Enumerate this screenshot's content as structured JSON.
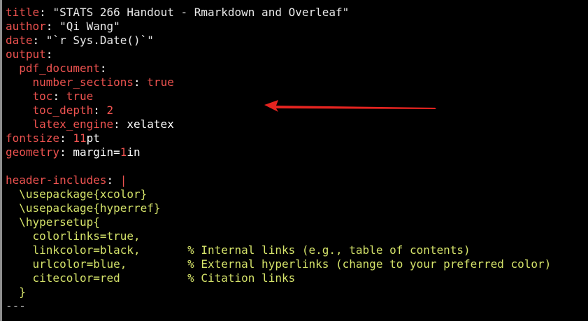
{
  "editor": {
    "lines": [
      {
        "name": "yaml-open-delim",
        "seg": [
          {
            "t": "---",
            "c": "fold"
          }
        ]
      },
      {
        "name": "title-line",
        "seg": [
          {
            "t": "title",
            "c": "k"
          },
          {
            "t": ": ",
            "c": "v"
          },
          {
            "t": "\"STATS 266 Handout - Rmarkdown and Overleaf\"",
            "c": "s"
          }
        ]
      },
      {
        "name": "author-line",
        "seg": [
          {
            "t": "author",
            "c": "k"
          },
          {
            "t": ": ",
            "c": "v"
          },
          {
            "t": "\"Qi Wang\"",
            "c": "s"
          }
        ]
      },
      {
        "name": "date-line",
        "seg": [
          {
            "t": "date",
            "c": "k"
          },
          {
            "t": ": ",
            "c": "v"
          },
          {
            "t": "\"`r Sys.Date()`\"",
            "c": "s"
          }
        ]
      },
      {
        "name": "output-line",
        "seg": [
          {
            "t": "output",
            "c": "k"
          },
          {
            "t": ":",
            "c": "v"
          }
        ]
      },
      {
        "name": "pdf-document-line",
        "seg": [
          {
            "t": "  ",
            "c": "v"
          },
          {
            "t": "pdf_document",
            "c": "k"
          },
          {
            "t": ":",
            "c": "v"
          }
        ]
      },
      {
        "name": "number-sections-line",
        "seg": [
          {
            "t": "    ",
            "c": "v"
          },
          {
            "t": "number_sections",
            "c": "k"
          },
          {
            "t": ": ",
            "c": "v"
          },
          {
            "t": "true",
            "c": "k"
          }
        ]
      },
      {
        "name": "toc-line",
        "seg": [
          {
            "t": "    ",
            "c": "v"
          },
          {
            "t": "toc",
            "c": "k"
          },
          {
            "t": ": ",
            "c": "v"
          },
          {
            "t": "true",
            "c": "k"
          }
        ]
      },
      {
        "name": "toc-depth-line",
        "seg": [
          {
            "t": "    ",
            "c": "v"
          },
          {
            "t": "toc_depth",
            "c": "k"
          },
          {
            "t": ": ",
            "c": "v"
          },
          {
            "t": "2",
            "c": "k"
          }
        ]
      },
      {
        "name": "latex-engine-line",
        "seg": [
          {
            "t": "    ",
            "c": "v"
          },
          {
            "t": "latex_engine",
            "c": "k"
          },
          {
            "t": ": ",
            "c": "v"
          },
          {
            "t": "xelatex",
            "c": "v"
          }
        ]
      },
      {
        "name": "fontsize-line",
        "seg": [
          {
            "t": "fontsize",
            "c": "k"
          },
          {
            "t": ": ",
            "c": "v"
          },
          {
            "t": "11",
            "c": "k"
          },
          {
            "t": "pt",
            "c": "v"
          }
        ]
      },
      {
        "name": "geometry-line",
        "seg": [
          {
            "t": "geometry",
            "c": "k"
          },
          {
            "t": ": ",
            "c": "v"
          },
          {
            "t": "margin=",
            "c": "v"
          },
          {
            "t": "1",
            "c": "k"
          },
          {
            "t": "in",
            "c": "v"
          }
        ]
      },
      {
        "name": "blank-line",
        "seg": [
          {
            "t": " ",
            "c": "v"
          }
        ]
      },
      {
        "name": "header-includes-line",
        "seg": [
          {
            "t": "header-includes",
            "c": "k"
          },
          {
            "t": ": ",
            "c": "v"
          },
          {
            "t": "|",
            "c": "k"
          }
        ]
      },
      {
        "name": "usepackage-xcolor-line",
        "seg": [
          {
            "t": "  \\usepackage{xcolor}",
            "c": "y"
          }
        ]
      },
      {
        "name": "usepackage-hyperref-line",
        "seg": [
          {
            "t": "  \\usepackage{hyperref}",
            "c": "y"
          }
        ]
      },
      {
        "name": "hypersetup-line",
        "seg": [
          {
            "t": "  \\hypersetup{",
            "c": "y"
          }
        ]
      },
      {
        "name": "colorlinks-line",
        "seg": [
          {
            "t": "    colorlinks=true,",
            "c": "y"
          }
        ]
      },
      {
        "name": "linkcolor-line",
        "seg": [
          {
            "t": "    linkcolor=black,       ",
            "c": "y"
          },
          {
            "t": "% Internal links (e.g., table of contents)",
            "c": "y"
          }
        ]
      },
      {
        "name": "urlcolor-line",
        "seg": [
          {
            "t": "    urlcolor=blue,         ",
            "c": "y"
          },
          {
            "t": "% External hyperlinks (change to your preferred color)",
            "c": "y"
          }
        ]
      },
      {
        "name": "citecolor-line",
        "seg": [
          {
            "t": "    citecolor=red          ",
            "c": "y"
          },
          {
            "t": "% Citation links",
            "c": "y"
          }
        ]
      },
      {
        "name": "hypersetup-close-line",
        "seg": [
          {
            "t": "  }",
            "c": "y"
          }
        ]
      },
      {
        "name": "yaml-close-delim",
        "seg": [
          {
            "t": "---",
            "c": "fold"
          }
        ]
      }
    ]
  },
  "annotation": {
    "arrow_color": "#e52420",
    "points_to": "toc-line"
  },
  "colors": {
    "background": "#000000",
    "key": "#ef5350",
    "latex": "#d5e36a",
    "text": "#e8e8e8"
  }
}
